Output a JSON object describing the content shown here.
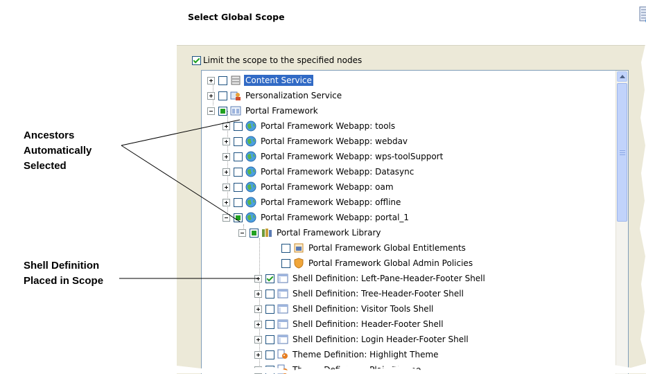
{
  "callouts": {
    "ancestors_lines": [
      "Ancestors",
      "Automatically",
      "Selected"
    ],
    "shell_lines": [
      "Shell Definition",
      "Placed in Scope"
    ]
  },
  "dialog": {
    "title": "Select Global Scope",
    "title_icon": "scope-wizard-icon",
    "limit_checkbox": {
      "label": "Limit the scope to the specified nodes",
      "checked": true
    }
  },
  "tree": {
    "nodes": [
      {
        "label": "Content Service",
        "icon": "server-icon",
        "expander": "plus",
        "check": "none",
        "selected": true
      },
      {
        "label": "Personalization Service",
        "icon": "personalization-icon",
        "expander": "plus",
        "check": "none"
      },
      {
        "label": "Portal Framework",
        "icon": "portal-framework-icon",
        "expander": "minus",
        "check": "partial"
      },
      {
        "label": "Portal Framework Webapp: tools",
        "icon": "globe-icon",
        "expander": "plus",
        "check": "none"
      },
      {
        "label": "Portal Framework Webapp: webdav",
        "icon": "globe-icon",
        "expander": "plus",
        "check": "none"
      },
      {
        "label": "Portal Framework Webapp: wps-toolSupport",
        "icon": "globe-icon",
        "expander": "plus",
        "check": "none"
      },
      {
        "label": "Portal Framework Webapp: Datasync",
        "icon": "globe-icon",
        "expander": "plus",
        "check": "none"
      },
      {
        "label": "Portal Framework Webapp: oam",
        "icon": "globe-icon",
        "expander": "plus",
        "check": "none"
      },
      {
        "label": "Portal Framework Webapp: offline",
        "icon": "globe-icon",
        "expander": "plus",
        "check": "none"
      },
      {
        "label": "Portal Framework Webapp: portal_1",
        "icon": "globe-icon",
        "expander": "minus",
        "check": "partial"
      },
      {
        "label": "Portal Framework Library",
        "icon": "library-icon",
        "expander": "minus",
        "check": "partial"
      },
      {
        "label": "Portal Framework Global Entitlements",
        "icon": "entitlements-icon",
        "expander": "none",
        "check": "none"
      },
      {
        "label": "Portal Framework Global Admin Policies",
        "icon": "shield-icon",
        "expander": "none",
        "check": "none"
      },
      {
        "label": "Shell Definition: Left-Pane-Header-Footer Shell",
        "icon": "shell-icon",
        "expander": "plus",
        "check": "checked"
      },
      {
        "label": "Shell Definition: Tree-Header-Footer Shell",
        "icon": "shell-icon",
        "expander": "plus",
        "check": "none"
      },
      {
        "label": "Shell Definition: Visitor Tools Shell",
        "icon": "shell-icon",
        "expander": "plus",
        "check": "none"
      },
      {
        "label": "Shell Definition: Header-Footer Shell",
        "icon": "shell-icon",
        "expander": "plus",
        "check": "none"
      },
      {
        "label": "Shell Definition: Login Header-Footer Shell",
        "icon": "shell-icon",
        "expander": "plus",
        "check": "none"
      },
      {
        "label": "Theme Definition: Highlight Theme",
        "icon": "theme-icon",
        "expander": "plus",
        "check": "none"
      },
      {
        "label": "Theme Definition: Plain Theme",
        "icon": "theme-icon",
        "expander": "plus",
        "check": "none"
      }
    ]
  },
  "colors": {
    "selection": "#316ac5",
    "check_green": "#21a121",
    "border": "#7f9db9"
  }
}
